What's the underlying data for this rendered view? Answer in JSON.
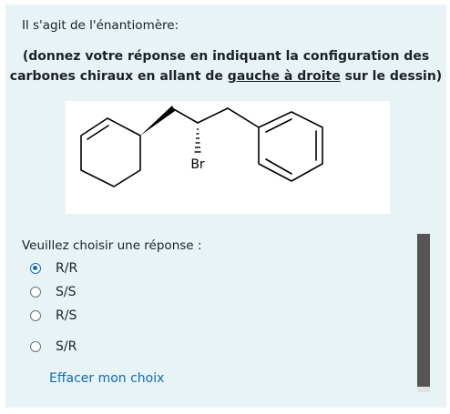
{
  "question": {
    "intro": "Il s'agit de l'énantiomère:",
    "instruction_line1": "(donnez votre réponse en indiquant la configuration des",
    "instruction_line2_before": "carbones chiraux en allant de ",
    "instruction_line2_underlined": "gauche à droite",
    "instruction_line2_after": " sur le dessin)",
    "molecule_atom_label": "Br"
  },
  "answer": {
    "prompt": "Veuillez choisir une réponse :",
    "options": [
      {
        "label": "R/R",
        "selected": true
      },
      {
        "label": "S/S",
        "selected": false
      },
      {
        "label": "R/S",
        "selected": false
      },
      {
        "label": "S/R",
        "selected": false
      }
    ],
    "clear_label": "Effacer mon choix"
  },
  "colors": {
    "card_background": "#e7f3f5",
    "accent": "#0f6cbf",
    "text": "#1d2125"
  }
}
